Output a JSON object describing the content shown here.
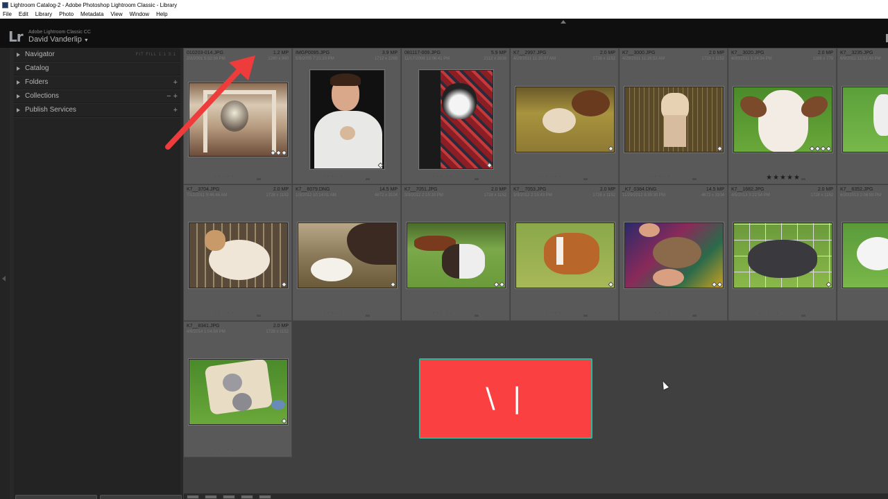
{
  "window": {
    "title": "Lightroom Catalog-2 - Adobe Photoshop Lightroom Classic - Library",
    "menu": [
      "File",
      "Edit",
      "Library",
      "Photo",
      "Metadata",
      "View",
      "Window",
      "Help"
    ]
  },
  "identity": {
    "logo": "Lr",
    "product": "Adobe Lightroom Classic CC",
    "user": "David Vanderlip"
  },
  "left_panel": {
    "navigator_zoom": "FIT  FILL  1:1  3:1",
    "sections": [
      {
        "label": "Navigator",
        "action": ""
      },
      {
        "label": "Catalog",
        "action": ""
      },
      {
        "label": "Folders",
        "action": "+"
      },
      {
        "label": "Collections",
        "action": "−  +"
      },
      {
        "label": "Publish Services",
        "action": "+"
      }
    ]
  },
  "grid": {
    "cells": [
      {
        "file": "010203-014.JPG",
        "mp": "1.2 MP",
        "date": "2/3/2001 5:32:36 PM",
        "dims": "1280 x 960",
        "stars": ""
      },
      {
        "file": "IMGP0095.JPG",
        "mp": "3.9 MP",
        "date": "5/9/2005 7:21:23 PM",
        "dims": "1712 x 2288",
        "stars": ""
      },
      {
        "file": "081117-009.JPG",
        "mp": "5.9 MP",
        "date": "11/17/2008 12:06:41 PM",
        "dims": "2112 x 2816",
        "stars": ""
      },
      {
        "file": "K7__2997.JPG",
        "mp": "2.0 MP",
        "date": "4/29/2011 11:15:07 AM",
        "dims": "1728 x 1152",
        "stars": ""
      },
      {
        "file": "K7__3000.JPG",
        "mp": "2.0 MP",
        "date": "4/29/2011 11:16:52 AM",
        "dims": "1728 x 1152",
        "stars": ""
      },
      {
        "file": "K7__3020.JPG",
        "mp": "2.0 MP",
        "date": "4/30/2011 1:24:34 PM",
        "dims": "1168 x 779",
        "stars": "★★★★★"
      },
      {
        "file": "K7__3235.JPG",
        "mp": "",
        "date": "6/9/2011 12:52:43 PM",
        "dims": "",
        "stars": ""
      },
      {
        "file": "K7__3704.JPG",
        "mp": "2.0 MP",
        "date": "7/12/2011 9:46:46 AM",
        "dims": "1728 x 1152",
        "stars": ""
      },
      {
        "file": "K7__6079.DNG",
        "mp": "14.5 MP",
        "date": "1/3/2012 10:14:01 AM",
        "dims": "4672 x 3104",
        "stars": ""
      },
      {
        "file": "K7__7051.JPG",
        "mp": "2.0 MP",
        "date": "3/3/2012 2:15:10 PM",
        "dims": "1728 x 1152",
        "stars": ""
      },
      {
        "file": "K7__7053.JPG",
        "mp": "2.0 MP",
        "date": "3/3/2012 2:15:43 PM",
        "dims": "1728 x 1152",
        "stars": ""
      },
      {
        "file": "_K7_0384.DNG",
        "mp": "14.5 MP",
        "date": "11/29/2012 8:35:30 PM",
        "dims": "4672 x 3104",
        "stars": ""
      },
      {
        "file": "K7__1682.JPG",
        "mp": "2.0 MP",
        "date": "4/5/2013 3:22:54 PM",
        "dims": "1728 x 1152",
        "stars": ""
      },
      {
        "file": "K7__6352.JPG",
        "mp": "",
        "date": "6/20/2013 2:06:59 PM",
        "dims": "",
        "stars": ""
      },
      {
        "file": "K7__8341.JPG",
        "mp": "2.0 MP",
        "date": "4/9/2014 1:04:58 PM",
        "dims": "1728 x 1152",
        "stars": ""
      }
    ]
  },
  "overlay": {
    "text": "\\ |",
    "color": "#fa4040"
  },
  "colors": {
    "accent_arrow": "#ee3b3b",
    "panel_bg": "#282828",
    "grid_bg": "#404040",
    "cell_bg": "#595959"
  }
}
